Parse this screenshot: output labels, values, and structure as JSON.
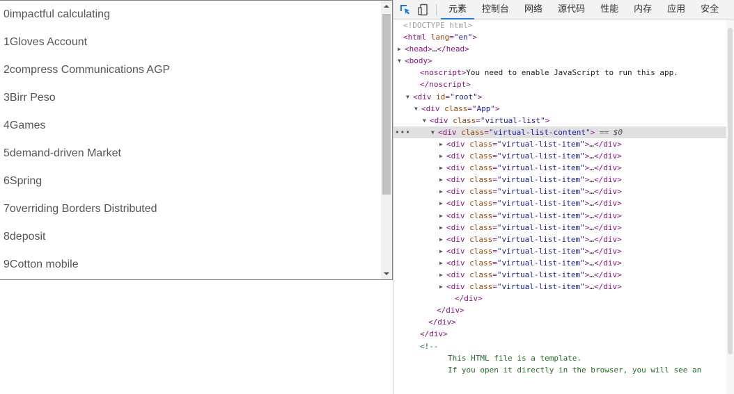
{
  "app": {
    "list_items": [
      "0impactful calculating",
      "1Gloves Account",
      "2compress Communications AGP",
      "3Birr Peso",
      "4Games",
      "5demand-driven Market",
      "6Spring",
      "7overriding Borders Distributed",
      "8deposit",
      "9Cotton mobile"
    ]
  },
  "devtools": {
    "toolbar": {
      "inspect_icon": "inspect-cursor-icon",
      "device_icon": "device-toolbar-icon",
      "tabs": [
        "元素",
        "控制台",
        "网络",
        "源代码",
        "性能",
        "内存",
        "应用",
        "安全"
      ],
      "active_tab": "元素"
    },
    "doctype": "<!DOCTYPE html>",
    "html_lang": "en",
    "noscript_text": "You need to enable JavaScript to run this app.",
    "root_id": "root",
    "app_class": "App",
    "vlist_class": "virtual-list",
    "content_class": "virtual-list-content",
    "selected_marker": "== $0",
    "item_class": "virtual-list-item",
    "item_count": 13,
    "comment_lines": [
      "This HTML file is a template.",
      "If you open it directly in the browser, you will see an"
    ],
    "colors": {
      "tag": "#881280",
      "attr_name": "#994500",
      "attr_value": "#1a1aa6",
      "active_tab_underline": "#1a73e8",
      "selected_row": "#e0e0e0"
    }
  }
}
